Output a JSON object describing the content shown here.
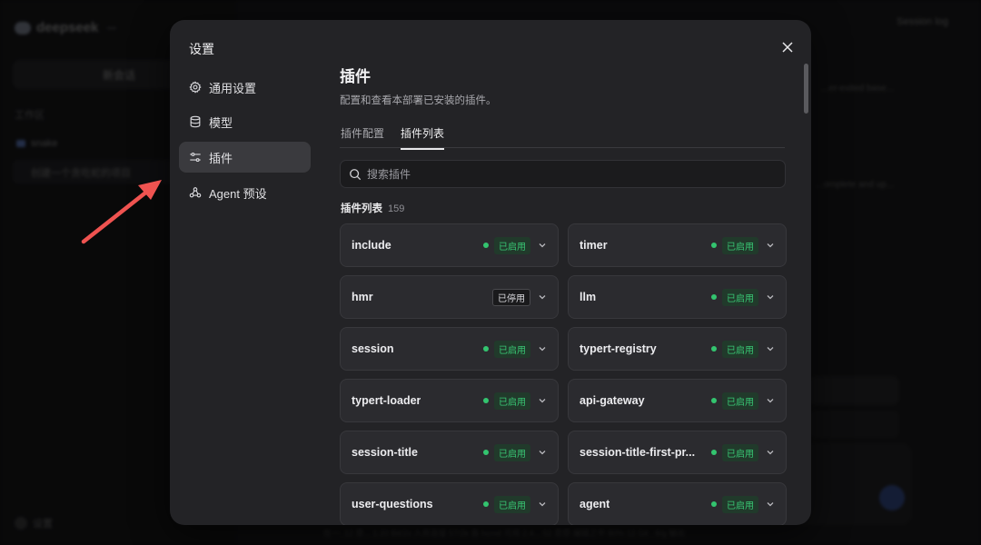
{
  "background": {
    "logo_text": "deepseek",
    "logo_badge": "",
    "new_chat_label": "新会话",
    "section_label": "工作区",
    "project_name": "snake",
    "session_label": "创建一个贪吃蛇的项目",
    "settings_label": "设置",
    "top_right_text": "Session log",
    "main_text_1": "...er-exited base...",
    "main_text_2": "...omplete and up...",
    "status_text": "在一. 12 思... 1.20 Bit/2s 入务连接 57/2k 各 hcmd 可用 2.4... 52 思想 编辑之中 80% 12 Git . 8/g 输出"
  },
  "modal": {
    "title": "设置",
    "nav": [
      {
        "label": "通用设置",
        "icon": "gear-icon"
      },
      {
        "label": "模型",
        "icon": "database-icon"
      },
      {
        "label": "插件",
        "icon": "sliders-icon"
      },
      {
        "label": "Agent 预设",
        "icon": "agent-icon"
      }
    ],
    "active_nav": "插件",
    "content": {
      "title": "插件",
      "description": "配置和查看本部署已安装的插件。",
      "tabs": [
        "插件配置",
        "插件列表"
      ],
      "active_tab": "插件列表",
      "search_placeholder": "搜索插件",
      "list_title": "插件列表",
      "list_count": "159",
      "plugins": [
        {
          "name": "include",
          "status": "已启用",
          "enabled": true
        },
        {
          "name": "timer",
          "status": "已启用",
          "enabled": true
        },
        {
          "name": "hmr",
          "status": "已停用",
          "enabled": false
        },
        {
          "name": "llm",
          "status": "已启用",
          "enabled": true
        },
        {
          "name": "session",
          "status": "已启用",
          "enabled": true
        },
        {
          "name": "typert-registry",
          "status": "已启用",
          "enabled": true
        },
        {
          "name": "typert-loader",
          "status": "已启用",
          "enabled": true
        },
        {
          "name": "api-gateway",
          "status": "已启用",
          "enabled": true
        },
        {
          "name": "session-title",
          "status": "已启用",
          "enabled": true
        },
        {
          "name": "session-title-first-pr...",
          "status": "已启用",
          "enabled": true
        },
        {
          "name": "user-questions",
          "status": "已启用",
          "enabled": true
        },
        {
          "name": "agent",
          "status": "已启用",
          "enabled": true
        }
      ]
    }
  },
  "colors": {
    "accent_green": "#33c46f",
    "annotation_red": "#ef5350"
  }
}
